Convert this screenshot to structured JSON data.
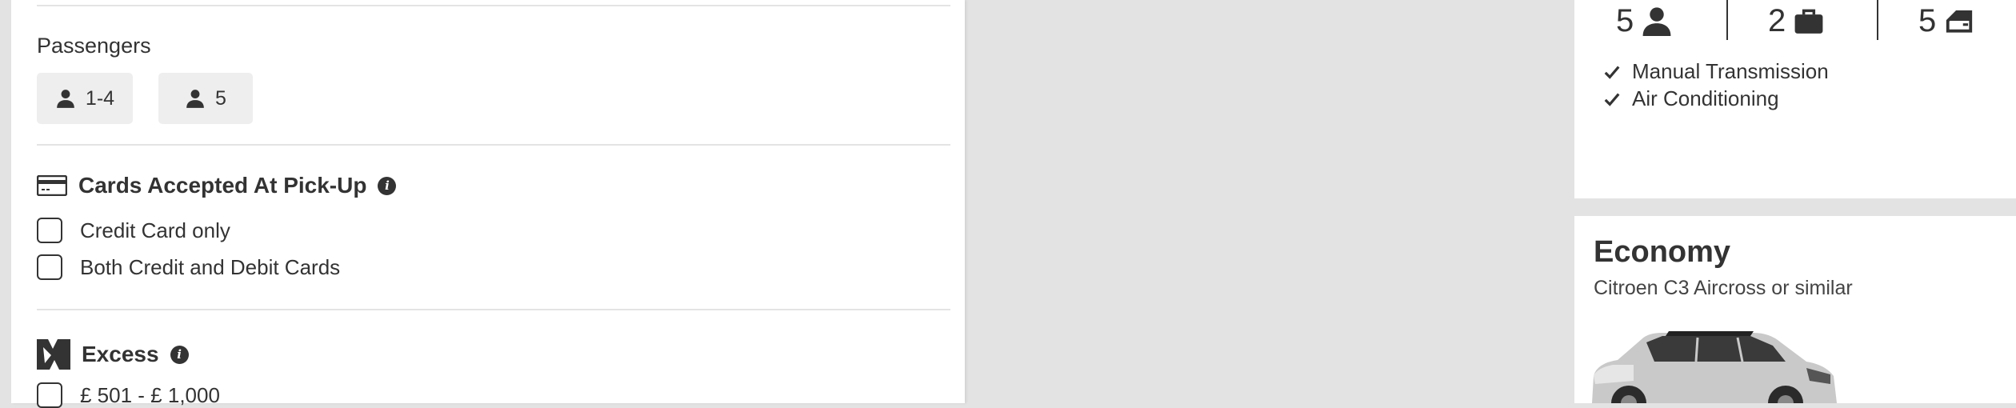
{
  "passengers": {
    "title": "Passengers",
    "options": [
      {
        "label": "1-4",
        "icon": "person-icon"
      },
      {
        "label": "5",
        "icon": "person-icon"
      }
    ]
  },
  "cards": {
    "title": "Cards Accepted At Pick-Up",
    "icon": "credit-card-icon",
    "options": [
      "Credit Card only",
      "Both Credit and Debit Cards"
    ]
  },
  "excess": {
    "title": "Excess",
    "icon": "car-damage-icon",
    "options": [
      "£ 501 - £ 1,000"
    ]
  },
  "car_top": {
    "specs": [
      {
        "value": "5",
        "icon": "person-icon"
      },
      {
        "value": "2",
        "icon": "suitcase-icon"
      },
      {
        "value": "5",
        "icon": "car-door-icon"
      }
    ],
    "features": [
      "Manual Transmission",
      "Air Conditioning"
    ]
  },
  "car_bottom": {
    "class": "Economy",
    "model": "Citroen C3 Aircross or similar"
  },
  "colors": {
    "text": "#333333",
    "pill_bg": "#eeeeee",
    "page_bg": "#e3e3e3",
    "divider": "#e4e4e4"
  }
}
